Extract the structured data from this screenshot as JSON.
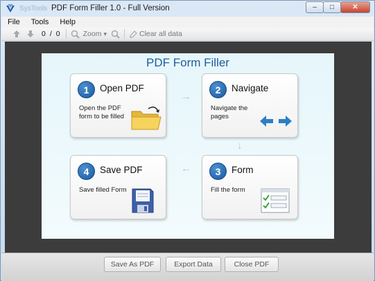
{
  "window": {
    "brand": "SysTools",
    "title": "PDF Form Filler 1.0 - Full Version",
    "controls": {
      "minimize": "–",
      "maximize": "□",
      "close": "✕"
    }
  },
  "menu": [
    "File",
    "Tools",
    "Help"
  ],
  "toolbar": {
    "current_page": "0",
    "slash": "/",
    "total_pages": "0",
    "zoom_label": "Zoom",
    "zoom_caret": "▾",
    "clear_label": "Clear all data"
  },
  "page": {
    "title": "PDF Form Filler",
    "steps": [
      {
        "number": "1",
        "title": "Open PDF",
        "desc": "Open the PDF form to be filled"
      },
      {
        "number": "2",
        "title": "Navigate",
        "desc": "Navigate the pages"
      },
      {
        "number": "3",
        "title": "Form",
        "desc": "Fill the form"
      },
      {
        "number": "4",
        "title": "Save PDF",
        "desc": "Save filled Form"
      }
    ],
    "arrows": {
      "right": "→",
      "down": "↓",
      "left": "←"
    }
  },
  "buttons": {
    "save_as_pdf": "Save As PDF",
    "export_data": "Export Data",
    "close_pdf": "Close PDF"
  },
  "colors": {
    "accent": "#1f5c99",
    "step_badge": "#1a5aa0",
    "viewer_bg": "#3c3c3c",
    "page_bg": "#e5f6fb"
  }
}
